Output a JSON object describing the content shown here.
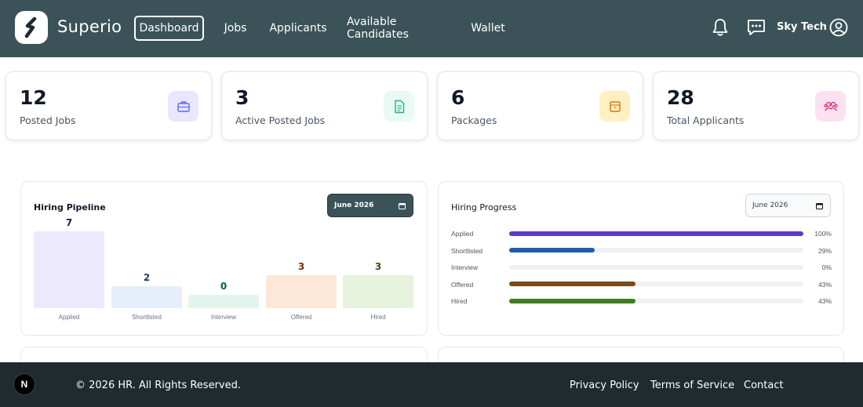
{
  "header": {
    "brand": "Superio",
    "nav": [
      {
        "label": "Dashboard",
        "active": true
      },
      {
        "label": "Jobs",
        "active": false
      },
      {
        "label": "Applicants",
        "active": false
      },
      {
        "label": "Available Candidates",
        "active": false
      },
      {
        "label": "Wallet",
        "active": false
      }
    ],
    "company": "Sky Tech",
    "icons": [
      "bell-icon",
      "chat-icon",
      "user-circle-icon"
    ]
  },
  "stats": [
    {
      "value": "12",
      "label": "Posted Jobs",
      "icon": "briefcase-icon",
      "color": "#6366f1"
    },
    {
      "value": "3",
      "label": "Active Posted Jobs",
      "icon": "document-icon",
      "color": "#10b981"
    },
    {
      "value": "6",
      "label": "Packages",
      "icon": "package-icon",
      "color": "#f59e0b"
    },
    {
      "value": "28",
      "label": "Total Applicants",
      "icon": "users-icon",
      "color": "#ec4899"
    }
  ],
  "pipeline": {
    "title": "Hiring Pipeline",
    "date": "June 2026",
    "stages": [
      {
        "label": "Applied",
        "value": "7",
        "color": "#1e1b4b"
      },
      {
        "label": "Shortlisted",
        "value": "2",
        "color": "#1e3a5f"
      },
      {
        "label": "Interview",
        "value": "0",
        "color": "#065f46"
      },
      {
        "label": "Offered",
        "value": "3",
        "color": "#7c2d12"
      },
      {
        "label": "Hired",
        "value": "3",
        "color": "#365314"
      }
    ]
  },
  "progress": {
    "title": "Hiring Progress",
    "date": "June 2026",
    "rows": [
      {
        "label": "Applied",
        "pct": "100%",
        "value": 100,
        "color": "#5b3cc4"
      },
      {
        "label": "Shortlisted",
        "pct": "29%",
        "value": 29,
        "color": "#1d5fa8"
      },
      {
        "label": "Interview",
        "pct": "0%",
        "value": 0,
        "color": "#9ca3af"
      },
      {
        "label": "Offered",
        "pct": "43%",
        "value": 43,
        "color": "#7a4a1a"
      },
      {
        "label": "Hired",
        "pct": "43%",
        "value": 43,
        "color": "#3f7d1e"
      }
    ]
  },
  "footer": {
    "copyright": "© 2026 HR. All Rights Reserved.",
    "links": [
      "Privacy Policy",
      "Terms of Service",
      "Contact"
    ],
    "badge": "N"
  }
}
